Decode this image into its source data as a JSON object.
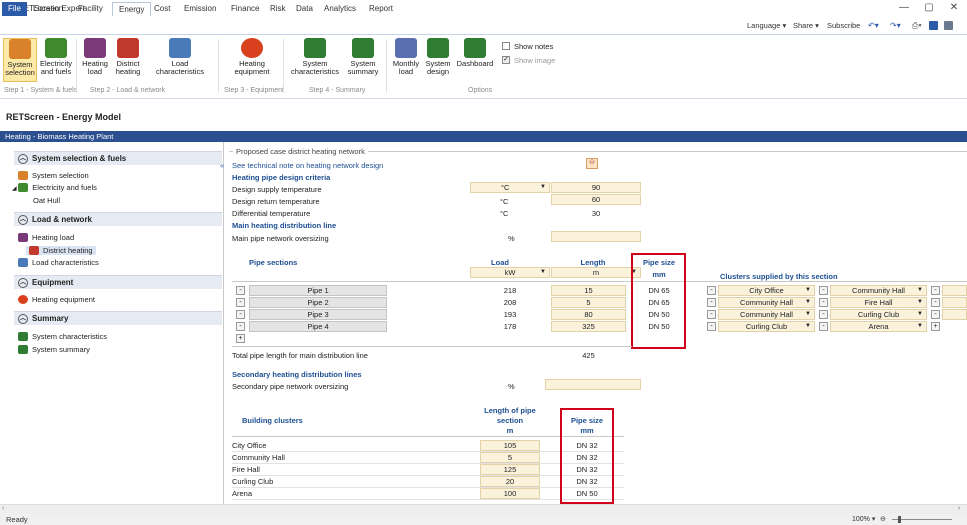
{
  "app": {
    "title": "RETScreen Expert"
  },
  "tabs": [
    "File",
    "Location",
    "Facility",
    "Energy",
    "Cost",
    "Emission",
    "Finance",
    "Risk",
    "Data",
    "Analytics",
    "Report"
  ],
  "topright": {
    "language": "Language ▾",
    "share": "Share ▾",
    "subscribe": "Subscribe"
  },
  "ribbon": {
    "buttons": [
      {
        "label1": "System",
        "label2": "selection",
        "color": "#d9822b"
      },
      {
        "label1": "Electricity",
        "label2": "and fuels",
        "color": "#3f8a2d"
      },
      {
        "label1": "Heating",
        "label2": "load",
        "color": "#7a3a7a"
      },
      {
        "label1": "District",
        "label2": "heating",
        "color": "#c0392b"
      },
      {
        "label1": "Load",
        "label2": "characteristics",
        "color": "#4a7ab8"
      },
      {
        "label1": "Heating",
        "label2": "equipment",
        "color": "#d9411e"
      },
      {
        "label1": "System",
        "label2": "characteristics",
        "color": "#2e7d32"
      },
      {
        "label1": "System",
        "label2": "summary",
        "color": "#2e7d32"
      },
      {
        "label1": "Monthly",
        "label2": "load",
        "color": "#5a6fb0"
      },
      {
        "label1": "System",
        "label2": "design",
        "color": "#2e7d32"
      },
      {
        "label1": "Dashboard",
        "label2": "",
        "color": "#2e7d32"
      }
    ],
    "groups": [
      "Step 1 - System & fuels",
      "Step 2 - Load & network",
      "Step 3 - Equipment",
      "Step 4 - Summary",
      "Options"
    ],
    "show_notes": "Show notes",
    "show_image": "Show image"
  },
  "model_title": "RETScreen - Energy Model",
  "plant_bar": "Heating - Biomass Heating Plant",
  "nav": {
    "sections": [
      {
        "title": "System selection & fuels",
        "items": [
          "System selection",
          "Electricity and fuels",
          "Oat Hull"
        ]
      },
      {
        "title": "Load & network",
        "items": [
          "Heating load",
          "District heating",
          "Load characteristics"
        ]
      },
      {
        "title": "Equipment",
        "items": [
          "Heating equipment"
        ]
      },
      {
        "title": "Summary",
        "items": [
          "System characteristics",
          "System summary"
        ]
      }
    ]
  },
  "main": {
    "group_title": "Proposed case district heating network",
    "tech_note": "See technical note on heating network design",
    "criteria_title": "Heating pipe design criteria",
    "supply_label": "Design supply temperature",
    "supply_unit": "°C",
    "supply_value": "90",
    "return_label": "Design return temperature",
    "return_unit": "°C",
    "return_value": "60",
    "diff_label": "Differential temperature",
    "diff_unit": "°C",
    "diff_value": "30",
    "main_line_title": "Main heating distribution line",
    "oversizing_label": "Main pipe network oversizing",
    "oversizing_unit": "%",
    "pipe_sections": "Pipe sections",
    "load": "Load",
    "load_unit": "kW",
    "length": "Length",
    "length_unit": "m",
    "pipe_size": "Pipe size",
    "pipe_size_unit": "mm",
    "clusters_title": "Clusters supplied by this section",
    "pipes": [
      {
        "name": "Pipe 1",
        "load": "218",
        "length": "15",
        "size": "DN 65",
        "c1": "City Office",
        "c2": "Community Hall"
      },
      {
        "name": "Pipe 2",
        "load": "208",
        "length": "5",
        "size": "DN 65",
        "c1": "Community Hall",
        "c2": "Fire Hall"
      },
      {
        "name": "Pipe 3",
        "load": "193",
        "length": "80",
        "size": "DN 50",
        "c1": "Community Hall",
        "c2": "Curling Club"
      },
      {
        "name": "Pipe 4",
        "load": "178",
        "length": "325",
        "size": "DN 50",
        "c1": "Curling Club",
        "c2": "Arena"
      }
    ],
    "total_label": "Total pipe length for main distribution line",
    "total_value": "425",
    "secondary_title": "Secondary heating distribution lines",
    "secondary_over_label": "Secondary pipe network oversizing",
    "secondary_over_unit": "%",
    "bc_title": "Building clusters",
    "bc_len_title1": "Length of pipe",
    "bc_len_title2": "section",
    "bc_len_unit": "m",
    "bc_size_title": "Pipe size",
    "bc_size_unit": "mm",
    "clusters": [
      {
        "name": "City Office",
        "length": "105",
        "size": "DN 32"
      },
      {
        "name": "Community Hall",
        "length": "5",
        "size": "DN 32"
      },
      {
        "name": "Fire Hall",
        "length": "125",
        "size": "DN 32"
      },
      {
        "name": "Curling Club",
        "length": "20",
        "size": "DN 32"
      },
      {
        "name": "Arena",
        "length": "100",
        "size": "DN 50"
      }
    ]
  },
  "status": {
    "ready": "Ready",
    "zoom": "100% ▾"
  }
}
